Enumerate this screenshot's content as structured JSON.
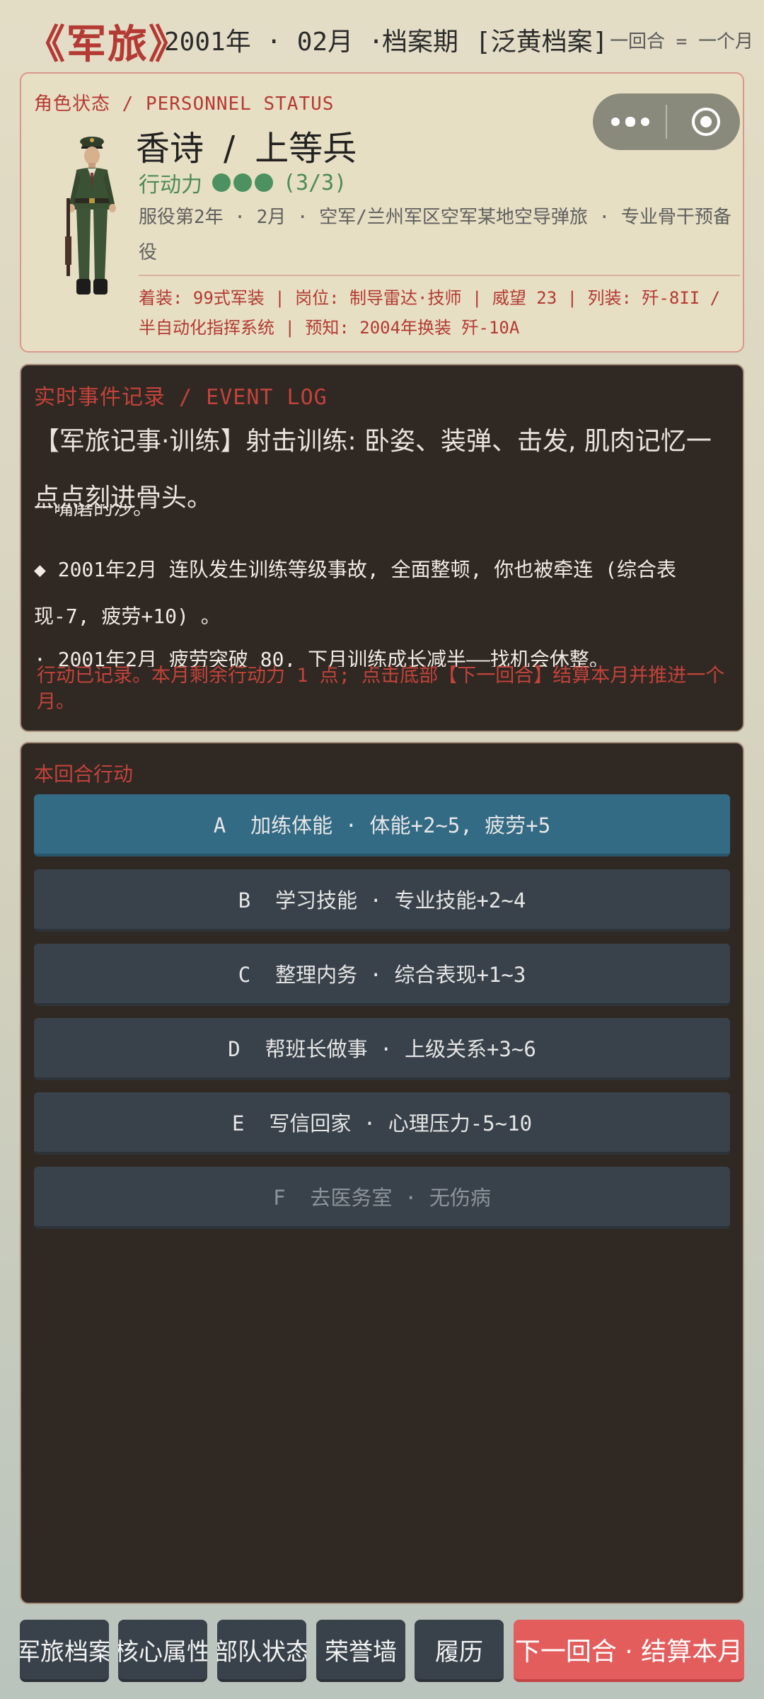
{
  "header": {
    "logo": "《军旅》",
    "date": "2001年 · 02月 ·",
    "period": "档案期",
    "tag": "[泛黄档案]",
    "turn_note": "一回合 = 一个月"
  },
  "status": {
    "title": "角色状态 / PERSONNEL STATUS",
    "name": "香诗",
    "rank": "上等兵",
    "action_points_label": "行动力",
    "action_points_current": 3,
    "action_points_max": 3,
    "action_points_text": "(3/3)",
    "info": "服役第2年 · 2月 · 空军/兰州军区空军某地空导弹旅 · 专业骨干预备役",
    "equipment": "着装: 99式军装 | 岗位: 制导雷达·技师 | 威望 23 | 列装: 歼-8II / 半自动化指挥系统 | 预知: 2004年换装 歼-10A"
  },
  "capsule": {
    "more_icon": "more-dots-icon",
    "close_icon": "target-circle-icon"
  },
  "event_log": {
    "title": "实时事件记录 / EVENT LOG",
    "headline": "【军旅记事·训练】射击训练: 卧姿、装弹、击发, 肌肉记忆一点点刻进骨头。",
    "fragment": "一嘴磨的沙。",
    "entry": "◆ 2001年2月 连队发生训练等级事故, 全面整顿, 你也被牵连 (综合表现-7, 疲劳+10) 。",
    "next_entry": "· 2001年2月 疲劳突破 80, 下月训练成长减半——找机会休整。",
    "status_text": "行动已记录。本月剩余行动力 1 点; 点击底部【下一回合】结算本月并推进一个月。"
  },
  "actions": {
    "title": "本回合行动",
    "items": [
      {
        "key": "A",
        "label": "A  加练体能 · 体能+2~5, 疲劳+5",
        "state": "active"
      },
      {
        "key": "B",
        "label": "B  学习技能 · 专业技能+2~4",
        "state": "normal"
      },
      {
        "key": "C",
        "label": "C  整理内务 · 综合表现+1~3",
        "state": "normal"
      },
      {
        "key": "D",
        "label": "D  帮班长做事 · 上级关系+3~6",
        "state": "normal"
      },
      {
        "key": "E",
        "label": "E  写信回家 · 心理压力-5~10",
        "state": "normal"
      },
      {
        "key": "F",
        "label": "F  去医务室 · 无伤病",
        "state": "disabled"
      }
    ]
  },
  "nav": {
    "tabs": [
      "军旅档案",
      "核心属性",
      "部队状态",
      "荣誉墙",
      "履历"
    ],
    "next": "下一回合 · 结算本月"
  },
  "colors": {
    "accent_red": "#b43a34",
    "active_action": "#336a84",
    "panel_dark": "#302822",
    "next_button": "#e35d5c",
    "ap_green": "#4d9161"
  }
}
